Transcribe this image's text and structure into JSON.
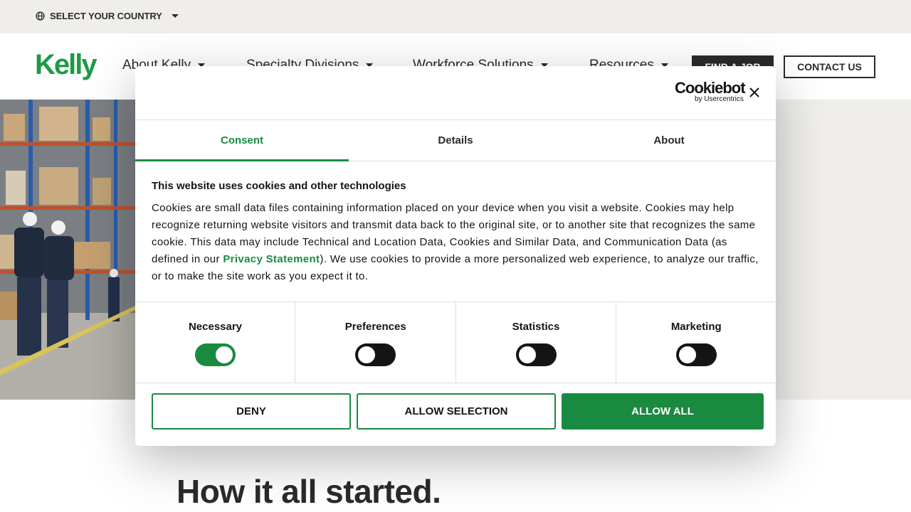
{
  "topbar": {
    "country_label": "SELECT YOUR COUNTRY"
  },
  "header": {
    "logo": "Kelly",
    "nav": [
      "About Kelly",
      "Specialty Divisions",
      "Workforce Solutions",
      "Resources"
    ],
    "find_job": "FIND A JOB",
    "contact": "CONTACT US"
  },
  "hero": {
    "headline": "How it all started."
  },
  "cookie_dialog": {
    "brand": "Cookiebot",
    "brand_sub": "by Usercentrics",
    "tabs": [
      "Consent",
      "Details",
      "About"
    ],
    "title": "This website uses cookies and other technologies",
    "text_before": "Cookies are small data files containing information placed on your device when you visit a website. Cookies may help recognize returning website visitors and transmit data back to the original site, or to another site that recognizes the same cookie. This data may include Technical and Location Data, Cookies and Similar Data, and Communication Data (as defined in our ",
    "link": "Privacy Statement",
    "text_after": "). We use cookies to provide a more personalized web experience, to analyze our traffic, or to make the site work as you expect it to.",
    "toggles": [
      {
        "label": "Necessary",
        "on": true
      },
      {
        "label": "Preferences",
        "on": false
      },
      {
        "label": "Statistics",
        "on": false
      },
      {
        "label": "Marketing",
        "on": false
      }
    ],
    "buttons": {
      "deny": "DENY",
      "selection": "ALLOW SELECTION",
      "all": "ALLOW ALL"
    }
  },
  "colors": {
    "accent": "#1a8a40",
    "dark": "#2b2b2b",
    "bar": "#efeeeb"
  }
}
